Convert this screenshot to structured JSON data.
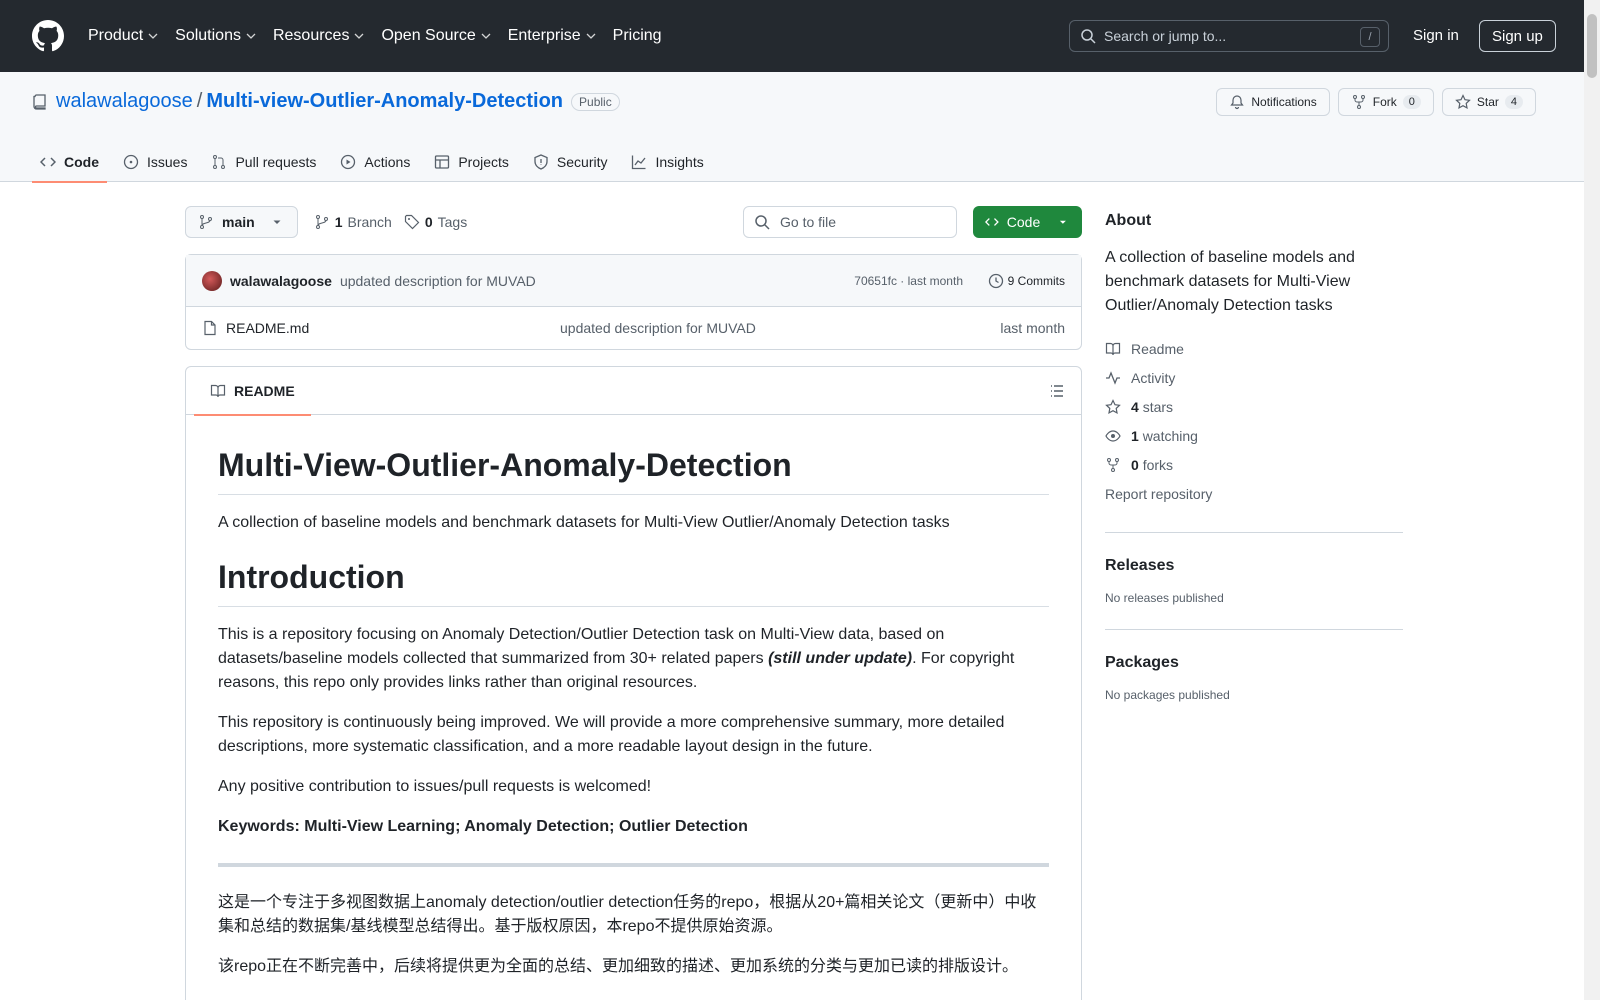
{
  "header": {
    "nav": [
      {
        "label": "Product",
        "has_menu": true
      },
      {
        "label": "Solutions",
        "has_menu": true
      },
      {
        "label": "Resources",
        "has_menu": true
      },
      {
        "label": "Open Source",
        "has_menu": true
      },
      {
        "label": "Enterprise",
        "has_menu": true
      },
      {
        "label": "Pricing",
        "has_menu": false
      }
    ],
    "search_placeholder": "Search or jump to...",
    "search_shortcut": "/",
    "sign_in": "Sign in",
    "sign_up": "Sign up"
  },
  "repo": {
    "owner": "walawalagoose",
    "separator": "/",
    "name": "Multi-view-Outlier-Anomaly-Detection",
    "visibility": "Public",
    "notifications_label": "Notifications",
    "fork_label": "Fork",
    "fork_count": "0",
    "star_label": "Star",
    "star_count": "4"
  },
  "tabs": [
    {
      "label": "Code",
      "icon": "code-icon",
      "active": true
    },
    {
      "label": "Issues",
      "icon": "issue-icon"
    },
    {
      "label": "Pull requests",
      "icon": "pull-request-icon"
    },
    {
      "label": "Actions",
      "icon": "play-icon"
    },
    {
      "label": "Projects",
      "icon": "table-icon"
    },
    {
      "label": "Security",
      "icon": "shield-icon"
    },
    {
      "label": "Insights",
      "icon": "graph-icon"
    }
  ],
  "code_view": {
    "branch": "main",
    "branch_count": "1",
    "branch_label": "Branch",
    "tag_count": "0",
    "tag_label": "Tags",
    "goto_placeholder": "Go to file",
    "code_button": "Code",
    "latest_commit": {
      "author": "walawalagoose",
      "message": "updated description for MUVAD",
      "hash_time": "70651fc · last month",
      "commits": "9 Commits"
    },
    "files": [
      {
        "name": "README.md",
        "message": "updated description for MUVAD",
        "date": "last month"
      }
    ]
  },
  "readme": {
    "tab_label": "README",
    "title": "Multi-View-Outlier-Anomaly-Detection",
    "subtitle": "A collection of baseline models and benchmark datasets for Multi-View Outlier/Anomaly Detection tasks",
    "intro_heading": "Introduction",
    "p1_before": "This is a repository focusing on Anomaly Detection/Outlier Detection task on Multi-View data, based on datasets/baseline models collected that summarized from 30+ related papers ",
    "p1_emph": "(still under update)",
    "p1_after": ". For copyright reasons, this repo only provides links rather than original resources.",
    "p2": "This repository is continuously being improved. We will provide a more comprehensive summary, more detailed descriptions, more systematic classification, and a more readable layout design in the future.",
    "p3": "Any positive contribution to issues/pull requests is welcomed!",
    "keywords": "Keywords: Multi-View Learning; Anomaly Detection; Outlier Detection",
    "zh1": "这是一个专注于多视图数据上anomaly detection/outlier detection任务的repo，根据从20+篇相关论文（更新中）中收集和总结的数据集/基线模型总结得出。基于版权原因，本repo不提供原始资源。",
    "zh2": "该repo正在不断完善中，后续将提供更为全面的总结、更加细致的描述、更加系统的分类与更加已读的排版设计。"
  },
  "sidebar": {
    "about_heading": "About",
    "about_desc": "A collection of baseline models and benchmark datasets for Multi-View Outlier/Anomaly Detection tasks",
    "links": [
      {
        "icon": "book-icon",
        "count": "",
        "label": "Readme"
      },
      {
        "icon": "pulse-icon",
        "count": "",
        "label": "Activity"
      },
      {
        "icon": "star-icon",
        "count": "4",
        "label": "stars"
      },
      {
        "icon": "eye-icon",
        "count": "1",
        "label": "watching"
      },
      {
        "icon": "fork-icon",
        "count": "0",
        "label": "forks"
      }
    ],
    "report": "Report repository",
    "releases_heading": "Releases",
    "releases_empty": "No releases published",
    "packages_heading": "Packages",
    "packages_empty": "No packages published"
  },
  "colors": {
    "header_bg": "#24292f",
    "link": "#0969da",
    "code_button": "#1f883d",
    "active_tab_underline": "#fd8c73"
  }
}
